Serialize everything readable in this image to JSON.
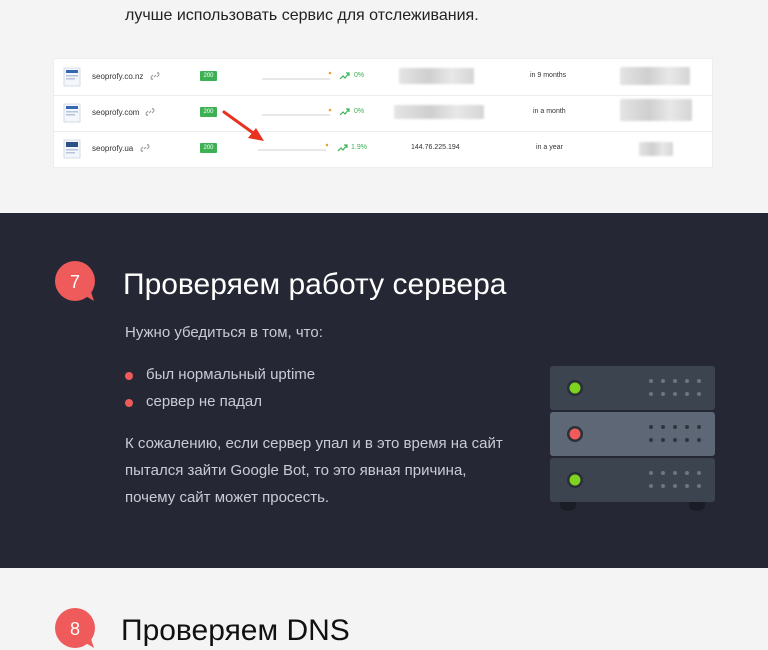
{
  "intro": {
    "text": "лучше использовать сервис для отслеживания."
  },
  "tracker": {
    "rows": [
      {
        "domain": "seoprofy.co.nz",
        "status": "200",
        "change": "0%",
        "ip": "",
        "age": "in 9 months"
      },
      {
        "domain": "seoprofy.com",
        "status": "200",
        "change": "0%",
        "ip": "",
        "age": "in a month"
      },
      {
        "domain": "seoprofy.ua",
        "status": "200",
        "change": "1.9%",
        "ip": "144.76.225.194",
        "age": "in a year"
      }
    ],
    "icons": {
      "link": "link-icon",
      "trend": "trend-up-icon",
      "arrow": "red-arrow-icon"
    },
    "colors": {
      "status": "#3db054",
      "trend": "#3db054",
      "arrow": "#e8321f"
    }
  },
  "section7": {
    "number": "7",
    "title": "Проверяем работу сервера",
    "lead": "Нужно убедиться в том, что:",
    "bullets": [
      "был нормальный uptime",
      "сервер не падал"
    ],
    "paragraph": "К сожалению, если сервер упал и в это время на сайт пытался зайти Google Bot, то это явная причина, почему сайт может просесть.",
    "illustration": "server-rack-icon",
    "colors": {
      "badge": "#ef5a5a",
      "background": "#252834"
    }
  },
  "section8": {
    "number": "8",
    "title": "Проверяем DNS"
  }
}
